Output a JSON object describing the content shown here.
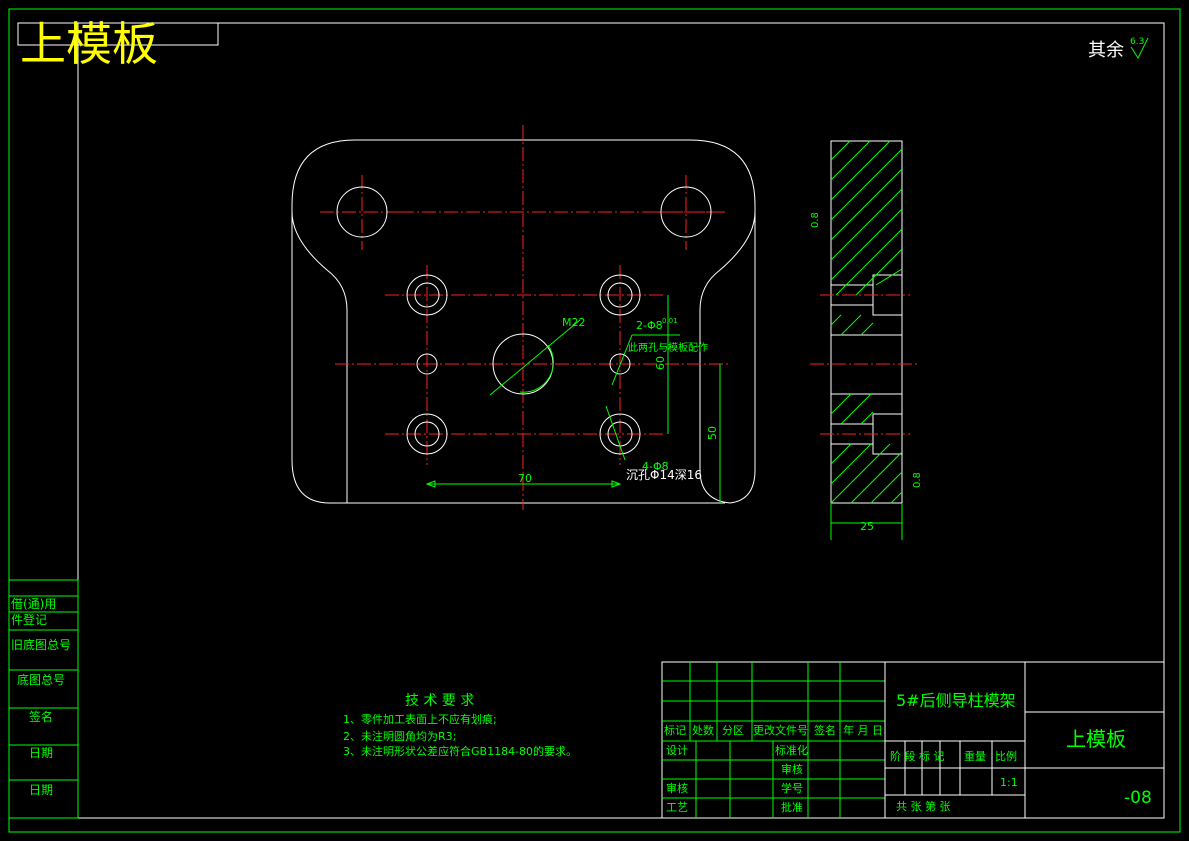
{
  "title_stamp": "上模板",
  "surface_finish": {
    "label": "其余",
    "value": "6.3"
  },
  "dimensions": {
    "width_70": "70",
    "height_50": "50",
    "height_60": "60",
    "thickness_25": "25",
    "thread": "M22",
    "hole_spec": "2-Φ8",
    "hole_tol": "0.01",
    "hole_note": "此两孔与模板配作",
    "counterbore": "沉孔Φ14深16",
    "counterbore_prefix": "4-Φ8",
    "roughness_top": "0.8",
    "roughness_bottom": "0.8"
  },
  "tech_requirements": {
    "title": "技 术 要 求",
    "items": [
      "1、零件加工表面上不应有划痕;",
      "2、未注明圆角均为R3;",
      "3、未注明形状公差应符合GB1184-80的要求。"
    ]
  },
  "left_strip": [
    "借(通)用",
    "件登记",
    "旧底图总号",
    "底图总号",
    "签名",
    "日期",
    "日期"
  ],
  "title_block": {
    "header_row": [
      "标记",
      "处数",
      "分区",
      "更改文件号",
      "签名",
      "年 月 日"
    ],
    "design": "设计",
    "standardize": "标准化",
    "review": "审核",
    "check": "审核",
    "process": "工艺",
    "approve": "批准",
    "seq": "学号",
    "product_name": "5#后侧导柱模架",
    "part_name": "上模板",
    "stage_labels": [
      "阶 段 标 记",
      "重量",
      "比例"
    ],
    "scale": "1:1",
    "sheets": "共  张 第  张",
    "drawing_no": "-08"
  }
}
